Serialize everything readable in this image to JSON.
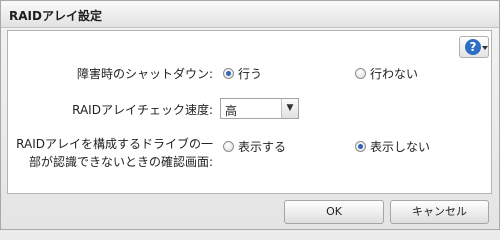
{
  "dialog": {
    "title": "RAIDアレイ設定"
  },
  "help": {
    "icon": "question-icon",
    "symbol": "?"
  },
  "fields": {
    "shutdown": {
      "label": "障害時のシャットダウン:",
      "options": [
        "行う",
        "行わない"
      ],
      "selected": "行う"
    },
    "check_speed": {
      "label": "RAIDアレイチェック速度:",
      "value": "高"
    },
    "confirm_screen": {
      "label_line1": "RAIDアレイを構成するドライブの一",
      "label_line2": "部が認識できないときの確認画面:",
      "options": [
        "表示する",
        "表示しない"
      ],
      "selected": "表示しない"
    }
  },
  "buttons": {
    "ok": "OK",
    "cancel": "キャンセル"
  }
}
